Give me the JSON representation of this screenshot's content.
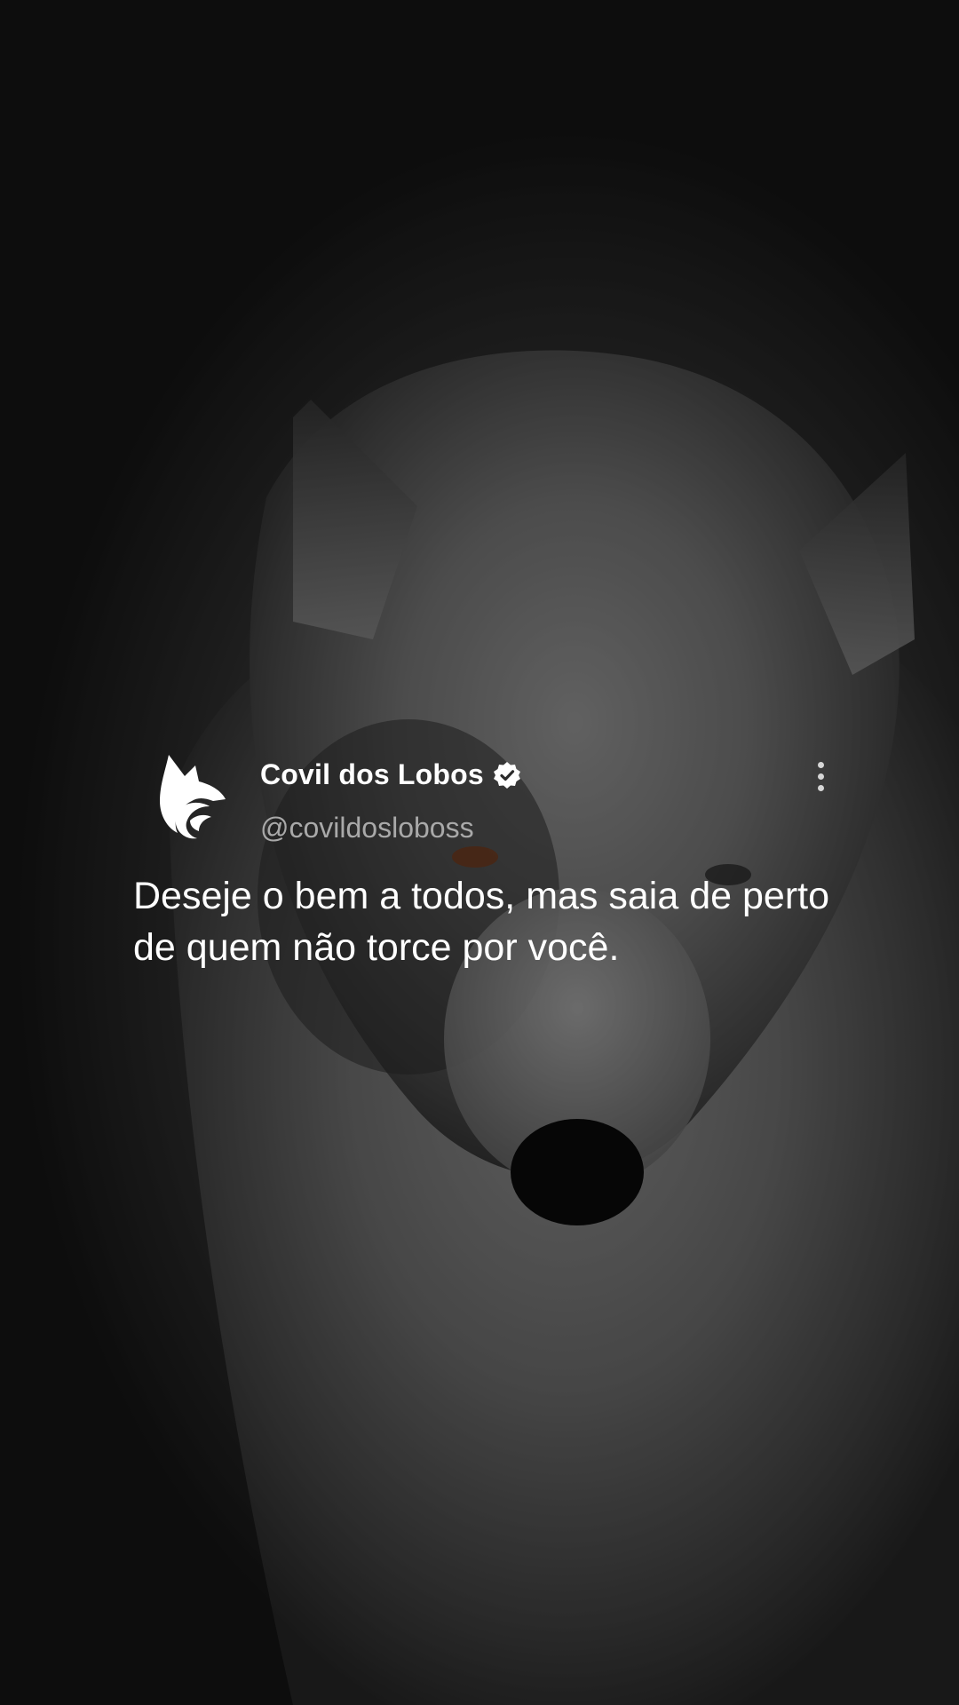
{
  "post": {
    "author": {
      "display_name": "Covil dos Lobos",
      "handle": "@covildosloboss",
      "verified": true,
      "avatar_icon": "wolf-logo-icon"
    },
    "text": "Deseje o bem a todos, mas saia de perto de quem não torce por você.",
    "menu_icon": "more-vertical-icon"
  },
  "background": {
    "subject": "wolf-photo"
  },
  "colors": {
    "name": "#ffffff",
    "handle": "#a9a9a9",
    "text": "#ffffff",
    "menu_dots": "#d6d6d6"
  }
}
